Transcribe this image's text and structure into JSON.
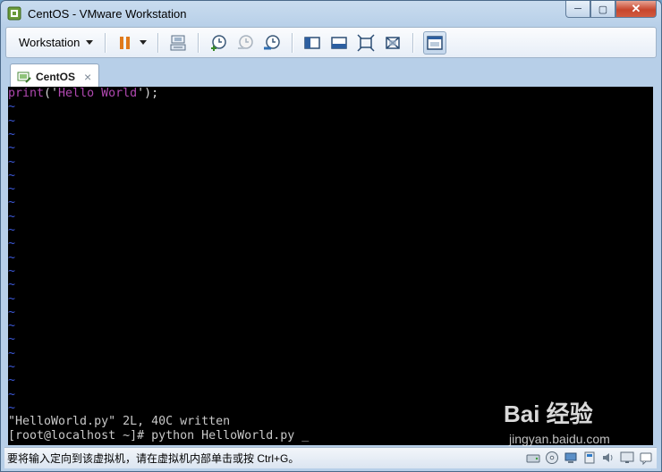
{
  "window": {
    "title": "CentOS - VMware Workstation",
    "controls": {
      "minimize": "─",
      "maximize": "▢",
      "close": "✕"
    }
  },
  "toolbar": {
    "menu_label": "Workstation",
    "icons": [
      "pause-icon",
      "dropdown-icon",
      "send-ctrl-alt-del-icon",
      "snapshot-take-icon",
      "snapshot-revert-icon",
      "snapshot-manager-icon",
      "sidebar-toggle-icon",
      "console-view-icon",
      "fullscreen-icon",
      "unity-icon",
      "thumbnail-view-icon"
    ]
  },
  "tabs": [
    {
      "label": "CentOS",
      "close": "×"
    }
  ],
  "console": {
    "code_line": {
      "func": "print",
      "open": "('",
      "string": "Hello World",
      "close": "');"
    },
    "tilde_count": 23,
    "tilde_char": "~",
    "status_line": "\"HelloWorld.py\" 2L, 40C written",
    "prompt_line": "[root@localhost ~]# python HelloWorld.py ",
    "cursor": "_"
  },
  "statusbar": {
    "text": "要将输入定向到该虚拟机，请在虚拟机内部单击或按 Ctrl+G。",
    "icons": [
      "hard-disk-icon",
      "cd-rom-icon",
      "network-icon",
      "usb-icon",
      "sound-icon",
      "display-icon",
      "message-icon"
    ]
  },
  "watermark": {
    "text": "Bai 经验",
    "sub": "jingyan.baidu.com"
  },
  "colors": {
    "accent": "#b048b0",
    "tilde": "#3b58d8",
    "close_button": "#c7462d"
  }
}
